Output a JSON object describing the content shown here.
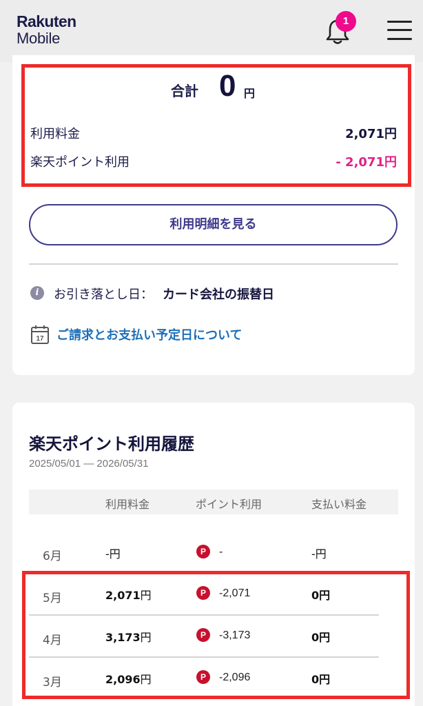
{
  "header": {
    "logo_line1": "Rakuten",
    "logo_line2": "Mobile",
    "notification_count": "1"
  },
  "summary": {
    "total_label": "合計",
    "total_value": "0",
    "total_unit": "円",
    "usage_fee_label": "利用料金",
    "usage_fee_value": "2,071円",
    "points_label": "楽天ポイント利用",
    "points_value": "- 2,071円",
    "details_button": "利用明細を見る",
    "debit_label": "お引き落とし日：",
    "debit_value": "カード会社の振替日",
    "schedule_link": "ご請求とお支払い予定日について",
    "calendar_day": "17"
  },
  "history": {
    "title": "楽天ポイント利用履歴",
    "range": "2025/05/01 — 2026/05/31",
    "columns": [
      "利用料金",
      "ポイント利用",
      "支払い料金"
    ],
    "point_icon": "P",
    "rows": [
      {
        "month": "6月",
        "fee_num": "-",
        "fee_unit": "円",
        "points": "-",
        "pay": "-円"
      },
      {
        "month": "5月",
        "fee_num": "2,071",
        "fee_unit": "円",
        "points": "-2,071",
        "pay": "0円"
      },
      {
        "month": "4月",
        "fee_num": "3,173",
        "fee_unit": "円",
        "points": "-3,173",
        "pay": "0円"
      },
      {
        "month": "3月",
        "fee_num": "2,096",
        "fee_unit": "円",
        "points": "-2,096",
        "pay": "0円"
      }
    ]
  },
  "colors": {
    "brand_navy": "#1c1c4a",
    "accent_pink": "#e0218a",
    "badge_pink": "#ee0a8c",
    "highlight_red": "#ee2a2a",
    "link_blue": "#1d6fb8",
    "point_red": "#c8102e"
  },
  "icons": [
    "bell-icon",
    "hamburger-menu-icon",
    "info-icon",
    "calendar-icon",
    "rakuten-point-icon"
  ]
}
